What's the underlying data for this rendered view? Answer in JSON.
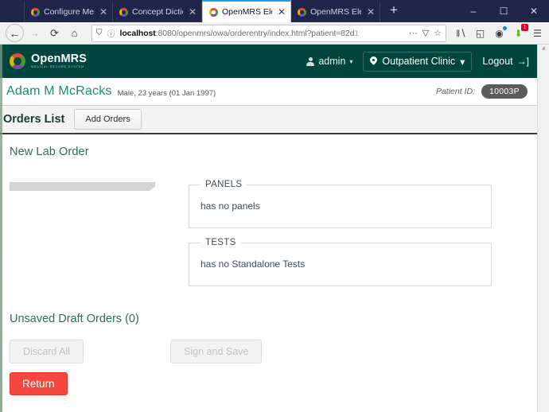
{
  "browser": {
    "tabs": [
      {
        "title": "Configure Metadata",
        "active": false,
        "favicon": "openmrs-favicon",
        "close": "✕"
      },
      {
        "title": "Concept Dictionary I",
        "active": false,
        "favicon": "openmrs-favicon",
        "close": "✕"
      },
      {
        "title": "OpenMRS Electronic",
        "active": true,
        "favicon": "openmrs-favicon",
        "close": "✕"
      },
      {
        "title": "OpenMRS Electronic",
        "active": false,
        "favicon": "openmrs-favicon",
        "close": "✕"
      }
    ],
    "new_tab_label": "+",
    "window_controls": {
      "minimize": "–",
      "maximize": "☐",
      "close": "✕"
    },
    "nav": {
      "back": "←",
      "forward": "→",
      "reload": "⟳",
      "home": "⌂"
    },
    "url": {
      "host": "localhost",
      "rest": ":8080/openmrs/owa/orderentry/index.html?patient=82d",
      "truncated_tail": "1",
      "shield_icon": "⛉",
      "info_icon": "ⓘ",
      "page_actions_icon": "···",
      "pocket_icon": "▽",
      "bookmark_icon": "☆"
    },
    "toolbar_icons": [
      {
        "name": "library-icon",
        "glyph": "‖∖"
      },
      {
        "name": "sidebar-icon",
        "glyph": "◱"
      },
      {
        "name": "account-icon",
        "glyph": "◉",
        "badge": ""
      },
      {
        "name": "downloads-icon",
        "glyph": "⬇",
        "badge": "1"
      },
      {
        "name": "menu-icon",
        "glyph": "☰"
      }
    ]
  },
  "openmrs_header": {
    "logo_name": "OpenMRS",
    "logo_sub": "MEDICAL RECORD SYSTEM",
    "user": "admin",
    "user_caret": "▾",
    "location": "Outpatient Clinic",
    "location_caret": "▾",
    "logout": "Logout",
    "logout_icon": "→]"
  },
  "patient": {
    "name": "Adam  M  McRacks",
    "demographics": "Male, 23 years (01 Jan 1997)",
    "id_label": "Patient ID:",
    "id_value": "10003P"
  },
  "orders_strip": {
    "title": "Orders List",
    "add_orders_label": "Add Orders"
  },
  "main": {
    "new_order_title": "New Lab Order",
    "groups": [
      {
        "legend": "PANELS",
        "empty_text": "has no panels"
      },
      {
        "legend": "TESTS",
        "empty_text": "has no Standalone Tests"
      }
    ],
    "draft_title": "Unsaved Draft Orders (0)",
    "discard_label": "Discard All",
    "sign_label": "Sign and Save",
    "return_label": "Return"
  },
  "colors": {
    "header_green": "#00463f",
    "patient_name_green": "#1f8a70",
    "return_red": "#f4473f",
    "browser_chrome": "#20264a",
    "active_tab_accent": "#1c9fe8"
  },
  "scrollbar": {
    "up_arrow": "ⱏ"
  }
}
